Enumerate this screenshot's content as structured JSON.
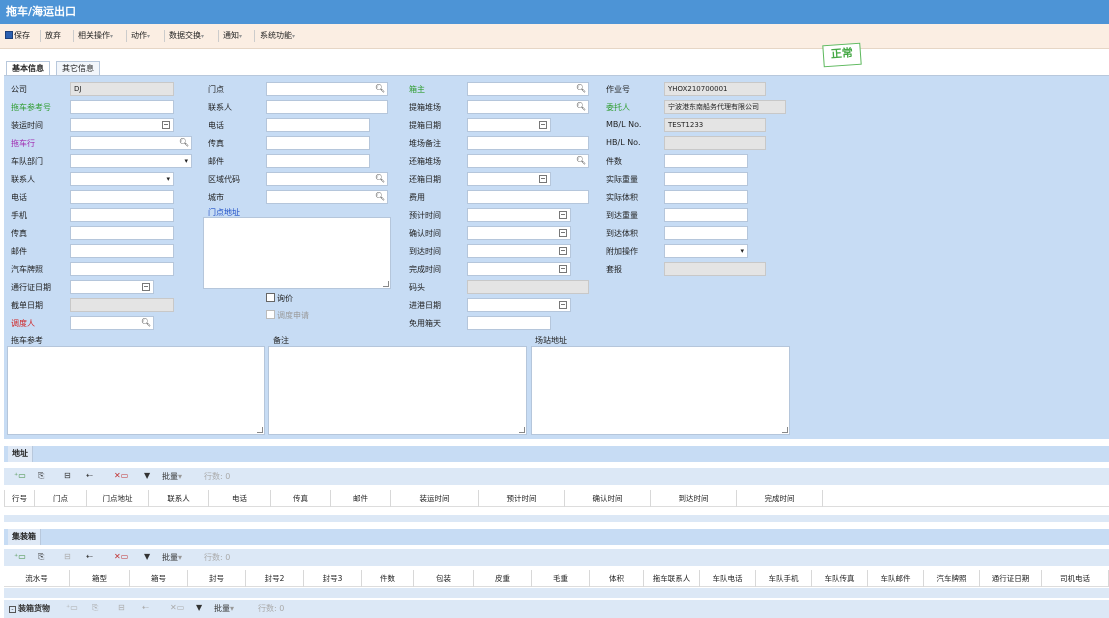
{
  "title": "拖车/海运出口",
  "toolbar": {
    "save": "保存",
    "discard": "放弃",
    "related_ops": "相关操作",
    "action": "动作",
    "data_exchange": "数据交换",
    "notify": "通知",
    "system": "系统功能",
    "dropdown_arrow": "▾"
  },
  "status_stamp": "正常",
  "tabs": {
    "basic": "基本信息",
    "other": "其它信息"
  },
  "form": {
    "col1": {
      "company_label": "公司",
      "company_value": "DJ",
      "tow_ref_label": "拖车参考号",
      "load_time_label": "装运时间",
      "tow_company_label": "拖车行",
      "fleet_dept_label": "车队部门",
      "contact_label": "联系人",
      "phone_label": "电话",
      "mobile_label": "手机",
      "fax_label": "传真",
      "email_label": "邮件",
      "plate_label": "汽车牌照",
      "permit_date_label": "通行证日期",
      "cutoff_date_label": "截单日期",
      "dispatcher_label": "调度人"
    },
    "col2": {
      "door_label": "门点",
      "contact_label": "联系人",
      "phone_label": "电话",
      "fax_label": "传真",
      "email_label": "邮件",
      "region_label": "区域代码",
      "city_label": "城市",
      "door_addr_label": "门点地址",
      "inquiry_label": "询价",
      "dispatch_req_label": "调度申请"
    },
    "col3": {
      "shipper_label": "箱主",
      "pickup_yard_label": "提箱堆场",
      "pickup_date_label": "提箱日期",
      "yard_remark_label": "堆场备注",
      "return_yard_label": "还箱堆场",
      "return_date_label": "还箱日期",
      "fee_label": "费用",
      "est_time_label": "预计时间",
      "confirm_time_label": "确认时间",
      "arrive_time_label": "到达时间",
      "finish_time_label": "完成时间",
      "terminal_label": "码头",
      "port_in_date_label": "进港日期",
      "free_days_label": "免用箱天"
    },
    "col4": {
      "job_no_label": "作业号",
      "job_no_value": "YHOX210700001",
      "client_label": "委托人",
      "client_value": "宁波港东南船务代理有限公司",
      "mbl_label": "MB/L No.",
      "mbl_value": "TEST1233",
      "hbl_label": "HB/L No.",
      "pieces_label": "件数",
      "actual_weight_label": "实际重量",
      "actual_volume_label": "实际体积",
      "arrive_weight_label": "到达重量",
      "arrive_volume_label": "到达体积",
      "extra_op_label": "附加操作",
      "customs_label": "套报"
    },
    "bottom": {
      "tow_ref_label": "拖车参考",
      "remark_label": "备注",
      "yard_addr_label": "场站地址"
    }
  },
  "grid_toolbar": {
    "batch": "批量",
    "rows": "行数: 0"
  },
  "address_section": {
    "title": "地址",
    "columns": [
      "行号",
      "门点",
      "门点地址",
      "联系人",
      "电话",
      "传真",
      "邮件",
      "装运时间",
      "预计时间",
      "确认时间",
      "到达时间",
      "完成时间"
    ]
  },
  "container_section": {
    "title": "集装箱",
    "columns": [
      "流水号",
      "箱型",
      "箱号",
      "封号",
      "封号2",
      "封号3",
      "件数",
      "包装",
      "皮重",
      "毛重",
      "体积",
      "拖车联系人",
      "车队电话",
      "车队手机",
      "车队传真",
      "车队邮件",
      "汽车牌照",
      "通行证日期",
      "司机电话"
    ]
  },
  "cargo_section": {
    "title": "装箱货物"
  },
  "icons": {
    "search": "🔍︎",
    "dropdown": "▾"
  }
}
